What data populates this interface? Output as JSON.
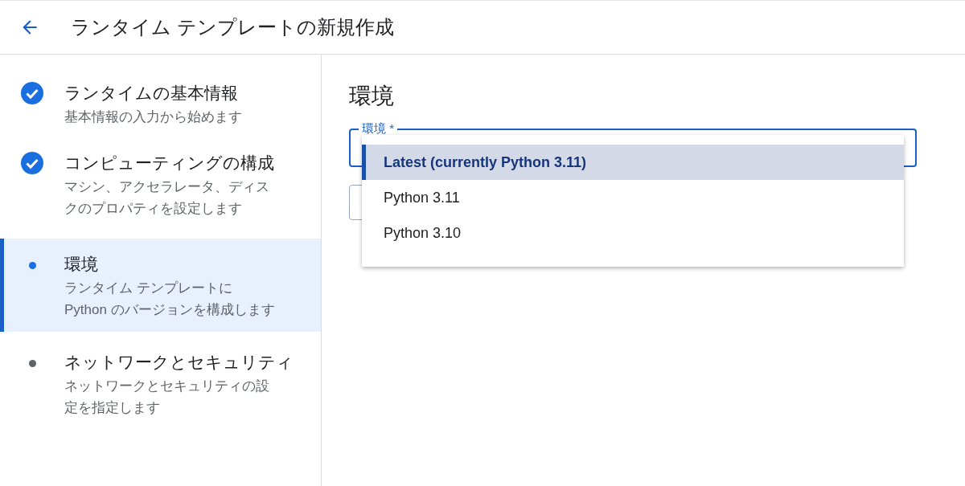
{
  "header": {
    "title": "ランタイム テンプレートの新規作成"
  },
  "steps": [
    {
      "title": "ランタイムの基本情報",
      "description": "基本情報の入力から始めます",
      "kind": "done",
      "selected": false
    },
    {
      "title": "コンピューティングの構成",
      "description": "マシン、アクセラレータ、ディスクのプロパティを設定します",
      "kind": "done",
      "selected": false
    },
    {
      "title": "環境",
      "description": "ランタイム テンプレートに Python のバージョンを構成します",
      "kind": "current",
      "selected": true
    },
    {
      "title": "ネットワークとセキュリティ",
      "description": "ネットワークとセキュリティの設定を指定します",
      "kind": "pending",
      "selected": false
    }
  ],
  "main": {
    "heading": "環境",
    "field": {
      "label": "環境 *"
    },
    "menu": [
      {
        "label": "Latest (currently Python 3.11)",
        "selected": true
      },
      {
        "label": "Python 3.11",
        "selected": false
      },
      {
        "label": "Python 3.10",
        "selected": false
      }
    ]
  }
}
